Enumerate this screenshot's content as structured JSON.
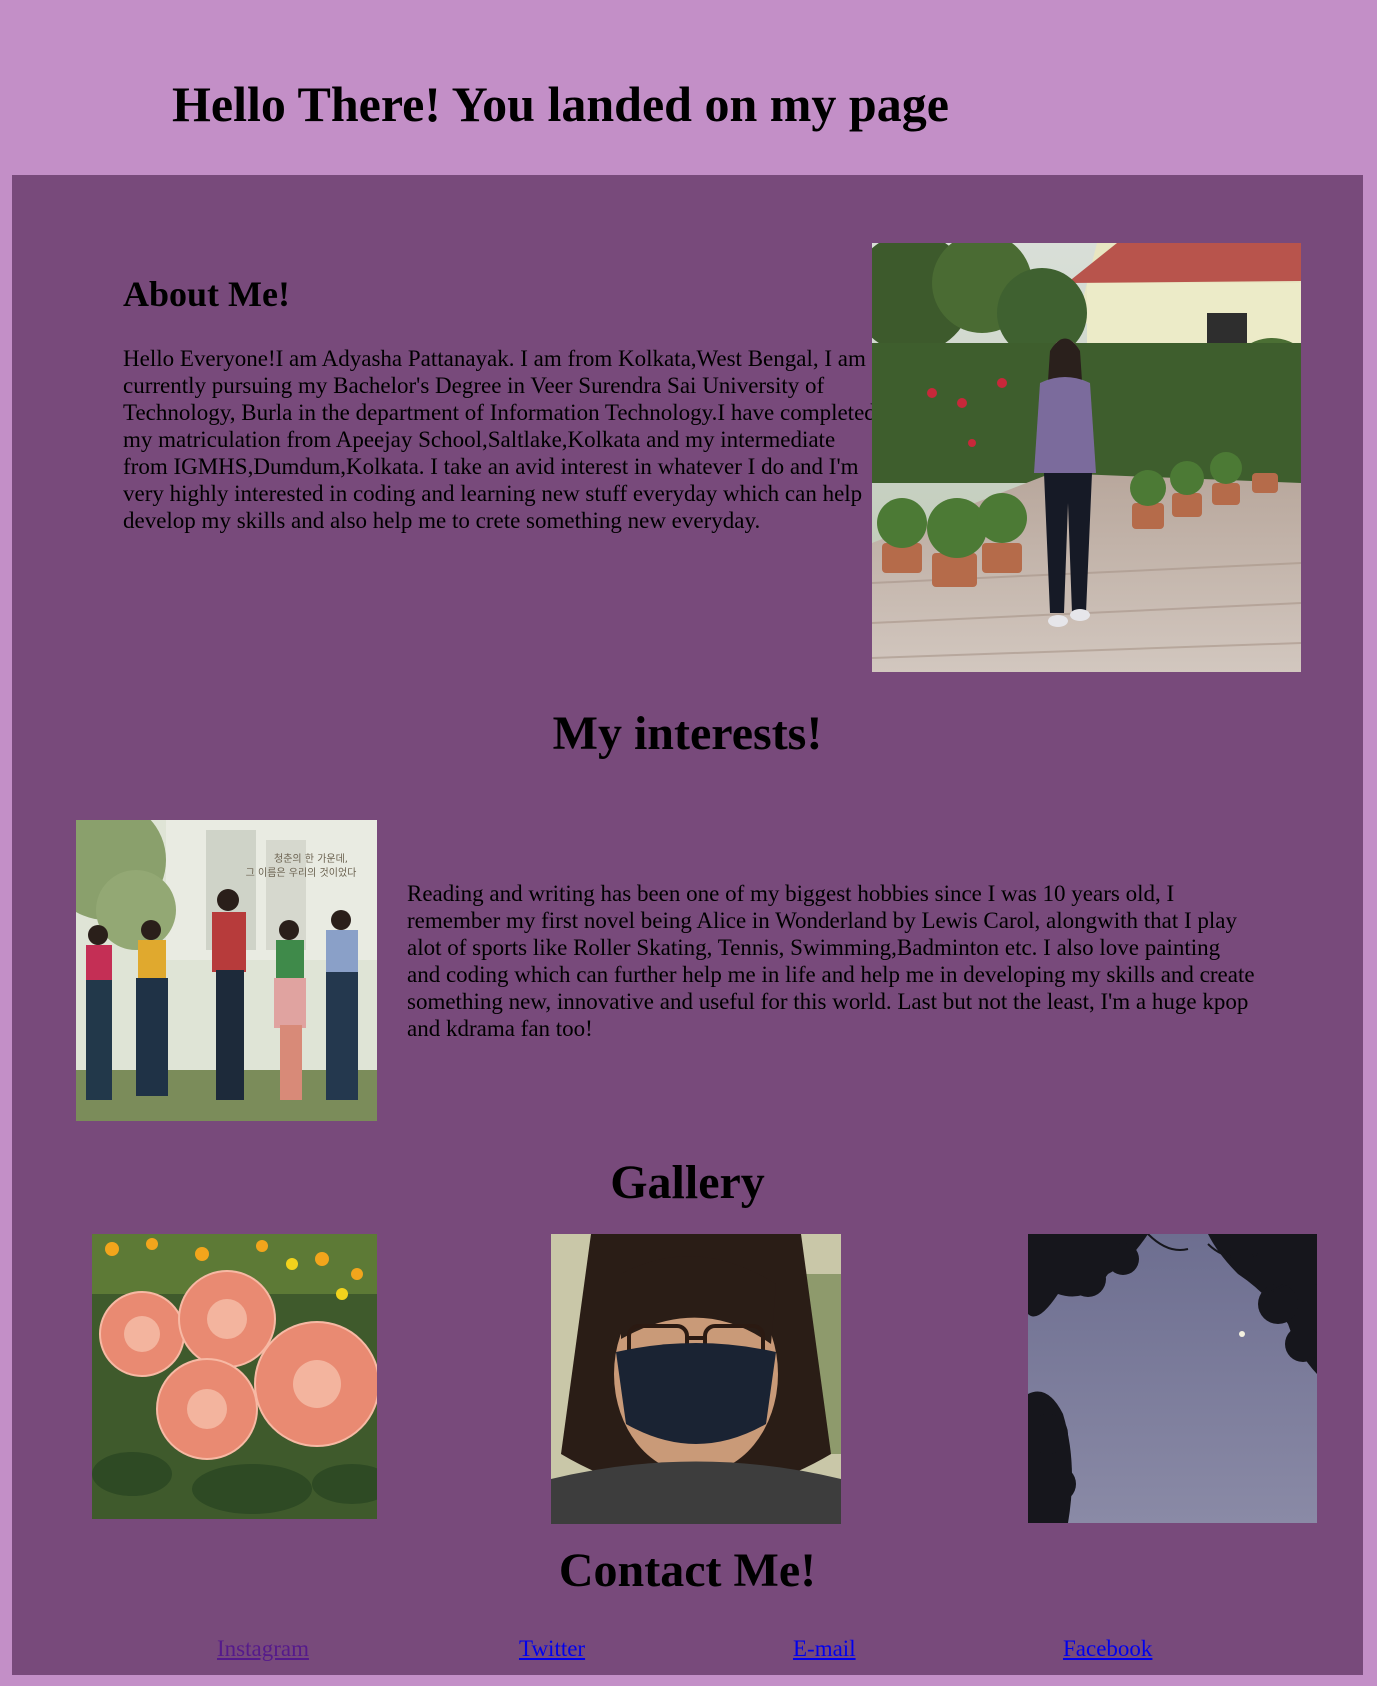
{
  "header": {
    "title": "Hello There! You landed on my page"
  },
  "about": {
    "heading": "About Me!",
    "text": "Hello Everyone!I am Adyasha Pattanayak. I am from Kolkata,West Bengal, I am currently pursuing my Bachelor's Degree in Veer Surendra Sai University of Technology, Burla in the department of Information Technology.I have completed my matriculation from Apeejay School,Saltlake,Kolkata and my intermediate from IGMHS,Dumdum,Kolkata. I take an avid interest in whatever I do and I'm very highly interested in coding and learning new stuff everyday which can help develop my skills and also help me to crete something new everyday.",
    "photo": "profile-photo-garden"
  },
  "interests": {
    "heading": "My interests!",
    "text": "Reading and writing has been one of my biggest hobbies since I was 10 years old, I remember my first novel being Alice in Wonderland by Lewis Carol, alongwith that I play alot of sports like Roller Skating, Tennis, Swimming,Badminton etc. I also love painting and coding which can further help me in life and help me in developing my skills and create something new, innovative and useful for this world. Last but not the least, I'm a huge kpop and kdrama fan too!",
    "photo": "kdrama-poster",
    "poster_text": [
      "청춘의 한 가운데,",
      "그 이름은 우리의 것이었다"
    ]
  },
  "gallery": {
    "heading": "Gallery",
    "images": [
      "dahlia-flowers-photo",
      "masked-selfie-photo",
      "moon-sky-photo"
    ]
  },
  "contact": {
    "heading": "Contact Me!",
    "links": [
      {
        "label": "Instagram",
        "visited": true
      },
      {
        "label": "Twitter",
        "visited": false
      },
      {
        "label": "E-mail",
        "visited": false
      },
      {
        "label": "Facebook",
        "visited": false
      }
    ]
  },
  "colors": {
    "background": "#c38fc7",
    "panel": "#784a7b",
    "link": "#0000ee",
    "link_visited": "#551a8b"
  }
}
